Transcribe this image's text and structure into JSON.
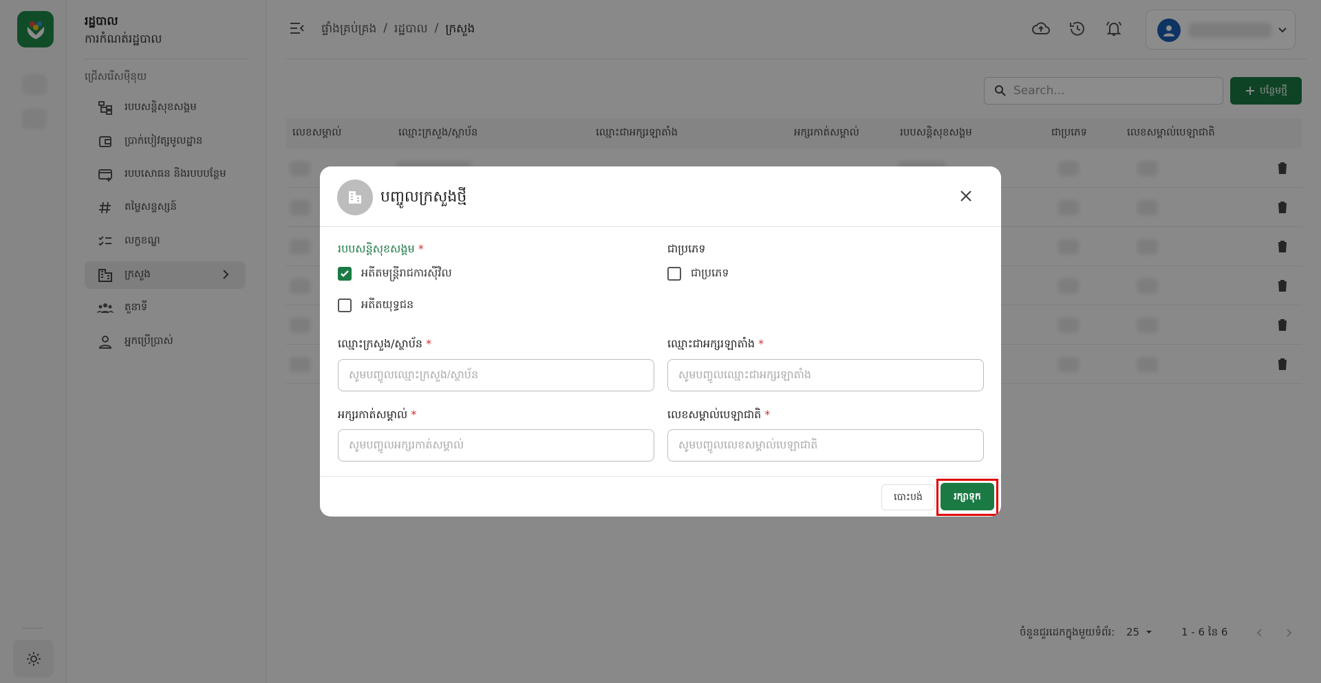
{
  "app": {
    "title": "រដ្ឋបាល",
    "subtitle": "ការកំណត់រដ្ឋបាល"
  },
  "sidebar": {
    "section_label": "ជ្រើសរើសម៉ឺនុយ",
    "items": [
      {
        "label": "របបសន្តិសុខសង្គម",
        "icon": "hierarchy-icon"
      },
      {
        "label": "ប្រាក់បៀវត្សមូលដ្ឋាន",
        "icon": "wallet-icon"
      },
      {
        "label": "របបសោធន និងរបបបន្ថែម",
        "icon": "card-add-icon"
      },
      {
        "label": "តម្លៃសន្ទស្សន៍",
        "icon": "hash-icon"
      },
      {
        "label": "លក្ខខណ្ឌ",
        "icon": "checklist-icon"
      },
      {
        "label": "ក្រសួង",
        "icon": "building-icon",
        "active": true
      },
      {
        "label": "តួនាទី",
        "icon": "group-icon"
      },
      {
        "label": "អ្នកប្រើប្រាស់",
        "icon": "person-icon"
      }
    ]
  },
  "breadcrumb": [
    "ផ្ទាំងគ្រប់គ្រង",
    "រដ្ឋបាល",
    "ក្រសួង"
  ],
  "toolbar": {
    "search_placeholder": "Search...",
    "add_label": "បន្ថែមថ្មី"
  },
  "table": {
    "columns": [
      "លេខសម្គាល់",
      "ឈ្មោះក្រសួង/ស្ថាប័ន",
      "ឈ្មោះជាអក្សរឡាតាំង",
      "អក្សរកាត់សម្គាល់",
      "របបសន្តិសុខសង្គម",
      "ជាប្រភេទ",
      "លេខសម្គាល់បេឡាជាតិ"
    ],
    "row_count": 6
  },
  "pagination": {
    "rows_per_page_label": "ចំនួនជួរដេកក្នុងមួយទំព័រ:",
    "rows_per_page": "25",
    "range": "1 - 6 នៃ 6"
  },
  "modal": {
    "title": "បញ្ចូលក្រសួងថ្មី",
    "scheme_label": "របបសន្តិសុខសង្គម",
    "scheme_options": [
      {
        "label": "អតីតមន្ត្រីរាជការស៊ីវិល",
        "checked": true
      },
      {
        "label": "អតីតយុទ្ធជន",
        "checked": false
      }
    ],
    "type_label": "ជាប្រភេទ",
    "type_option": {
      "label": "ជាប្រភេទ",
      "checked": false
    },
    "fields": {
      "name_label": "ឈ្មោះក្រសួង/ស្ថាប័ន",
      "name_placeholder": "សូមបញ្ចូលឈ្មោះក្រសួង/ស្ថាប័ន",
      "latin_label": "ឈ្មោះជាអក្សរឡាតាំង",
      "latin_placeholder": "សូមបញ្ចូលឈ្មោះជាអក្សរឡាតាំង",
      "abbr_label": "អក្សរកាត់សម្គាល់",
      "abbr_placeholder": "សូមបញ្ចូលអក្សរកាត់សម្គាល់",
      "nssf_label": "លេខសម្គាល់បេឡាជាតិ",
      "nssf_placeholder": "សូមបញ្ចូលលេខសម្គាល់បេឡាជាតិ"
    },
    "required_mark": "*",
    "cancel_label": "បោះបង់",
    "save_label": "រក្សាទុក"
  },
  "colors": {
    "primary": "#1b7a44",
    "highlight": "#e00000",
    "required": "#d32f2f"
  }
}
